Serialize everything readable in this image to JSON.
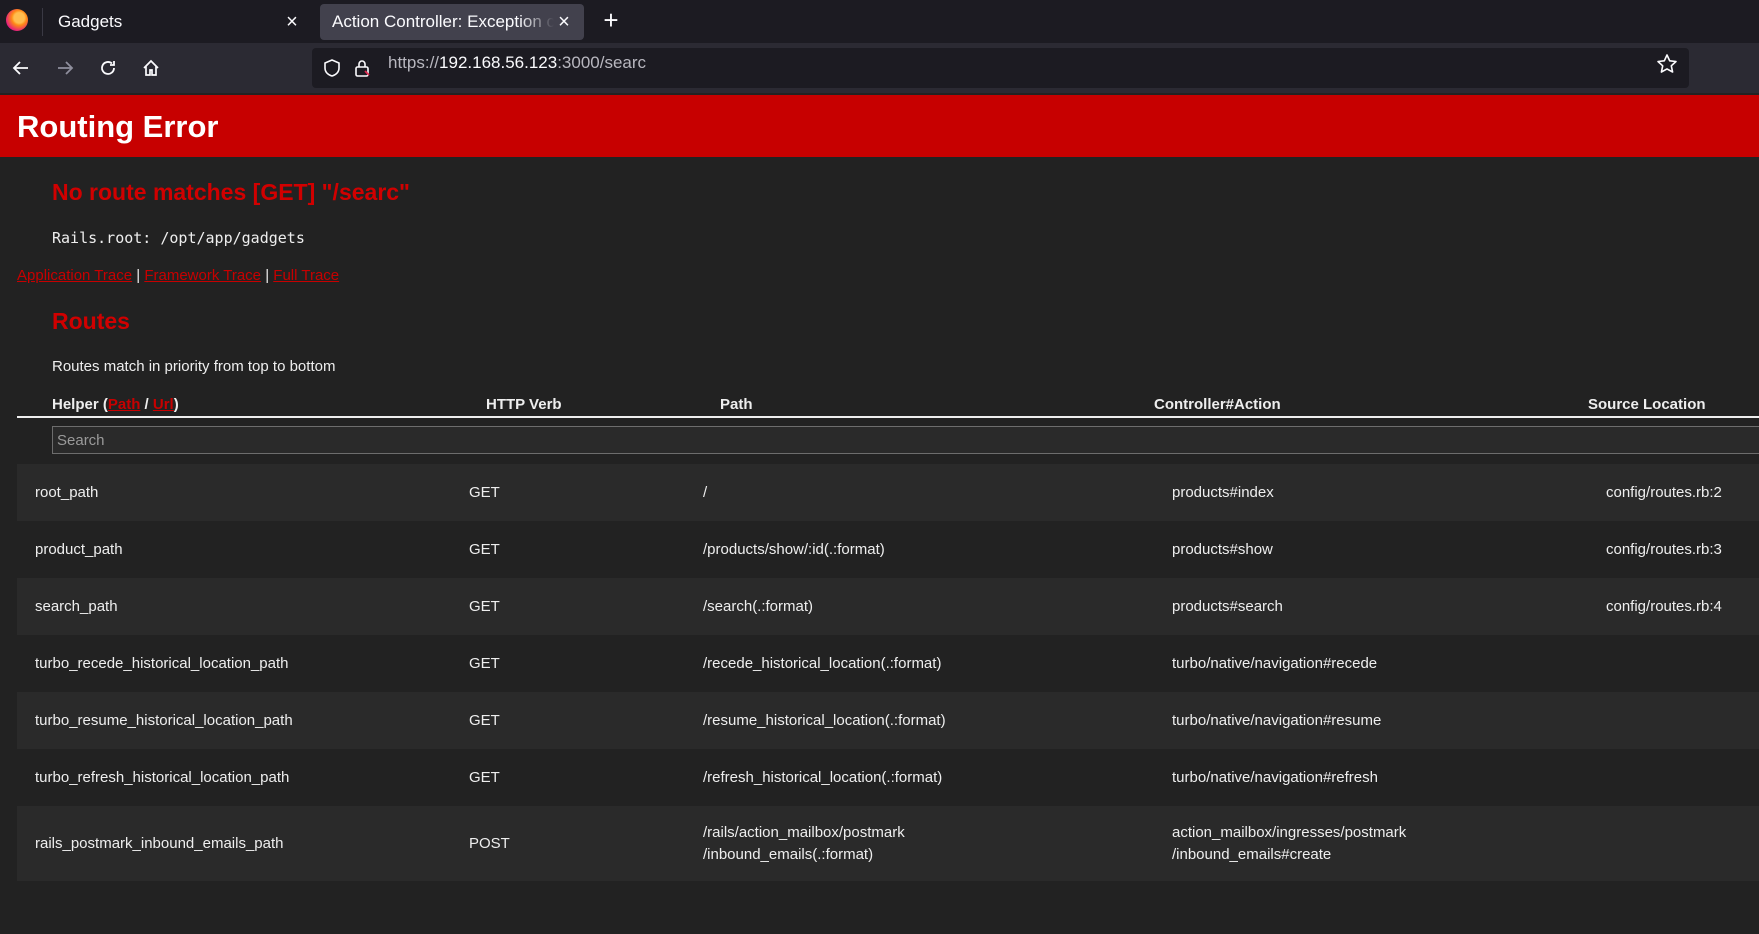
{
  "browser": {
    "tabs": [
      {
        "title": "Gadgets",
        "active": false
      },
      {
        "title": "Action Controller: Exception caught",
        "active": true
      }
    ],
    "url_scheme": "https://",
    "url_host": "192.168.56.123",
    "url_rest": ":3000/searc"
  },
  "error": {
    "banner": "Routing Error",
    "message": "No route matches [GET] \"/searc\"",
    "rails_root": "Rails.root: /opt/app/gadgets",
    "trace_links": [
      "Application Trace",
      "Framework Trace",
      "Full Trace"
    ],
    "trace_sep": "|"
  },
  "routes": {
    "heading": "Routes",
    "note": "Routes match in priority from top to bottom",
    "headers": {
      "helper_prefix": "Helper (",
      "helper_path": "Path",
      "helper_slash": " / ",
      "helper_url": "Url",
      "helper_suffix": ")",
      "verb": "HTTP Verb",
      "path": "Path",
      "action": "Controller#Action",
      "source": "Source Location"
    },
    "search_placeholder": "Search",
    "rows": [
      {
        "helper": "root_path",
        "verb": "GET",
        "path": [
          "/"
        ],
        "action": [
          "products#index"
        ],
        "source": "config/routes.rb:2"
      },
      {
        "helper": "product_path",
        "verb": "GET",
        "path": [
          "/products/show/:id(.:format)"
        ],
        "action": [
          "products#show"
        ],
        "source": "config/routes.rb:3"
      },
      {
        "helper": "search_path",
        "verb": "GET",
        "path": [
          "/search(.:format)"
        ],
        "action": [
          "products#search"
        ],
        "source": "config/routes.rb:4"
      },
      {
        "helper": "turbo_recede_historical_location_path",
        "verb": "GET",
        "path": [
          "/recede_historical_location(.:format)"
        ],
        "action": [
          "turbo/native/navigation#recede"
        ],
        "source": ""
      },
      {
        "helper": "turbo_resume_historical_location_path",
        "verb": "GET",
        "path": [
          "/resume_historical_location(.:format)"
        ],
        "action": [
          "turbo/native/navigation#resume"
        ],
        "source": ""
      },
      {
        "helper": "turbo_refresh_historical_location_path",
        "verb": "GET",
        "path": [
          "/refresh_historical_location(.:format)"
        ],
        "action": [
          "turbo/native/navigation#refresh"
        ],
        "source": ""
      },
      {
        "helper": "rails_postmark_inbound_emails_path",
        "verb": "POST",
        "path": [
          "/rails/action_mailbox/postmark",
          "/inbound_emails(.:format)"
        ],
        "action": [
          "action_mailbox/ingresses/postmark",
          "/inbound_emails#create"
        ],
        "source": ""
      }
    ]
  },
  "colors": {
    "accent_red": "#c70000",
    "page_bg": "#222222",
    "browser_chrome": "#2b2a33"
  },
  "icons": [
    "firefox-logo",
    "close-icon",
    "plus-icon",
    "back-arrow-icon",
    "forward-arrow-icon",
    "reload-icon",
    "home-icon",
    "shield-icon",
    "lock-icon",
    "star-icon"
  ]
}
